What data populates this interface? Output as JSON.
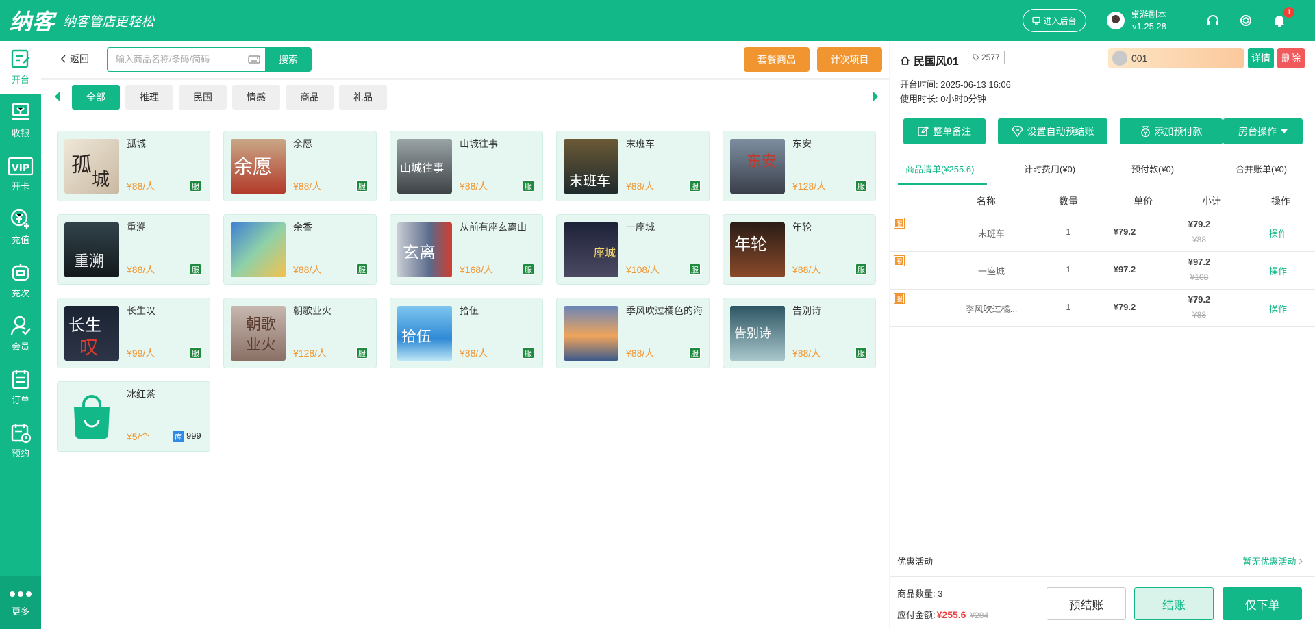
{
  "header": {
    "logo_text": "纳客",
    "slogan": "纳客管店更轻松",
    "enter_backend": "进入后台",
    "user_name": "桌游剧本",
    "version": "v1.25.28",
    "notification_count": "1"
  },
  "nav": {
    "items": [
      {
        "label": "开台",
        "icon": "open-table-icon"
      },
      {
        "label": "收银",
        "icon": "cashier-icon"
      },
      {
        "label": "开卡",
        "icon": "vip-card-icon"
      },
      {
        "label": "充值",
        "icon": "recharge-icon"
      },
      {
        "label": "充次",
        "icon": "recharge-times-icon"
      },
      {
        "label": "会员",
        "icon": "member-icon"
      },
      {
        "label": "订单",
        "icon": "order-icon"
      },
      {
        "label": "预约",
        "icon": "booking-icon"
      }
    ],
    "more": "更多"
  },
  "toolbar": {
    "back": "返回",
    "search_placeholder": "输入商品名称/条码/简码",
    "search_button": "搜索",
    "package_button": "套餐商品",
    "times_button": "计次项目"
  },
  "categories": [
    "全部",
    "推理",
    "民国",
    "情感",
    "商品",
    "礼品"
  ],
  "products": [
    {
      "name": "孤城",
      "price": "¥88/人",
      "tag": "服"
    },
    {
      "name": "余愿",
      "price": "¥88/人",
      "tag": "服"
    },
    {
      "name": "山城往事",
      "price": "¥88/人",
      "tag": "服"
    },
    {
      "name": "末班车",
      "price": "¥88/人",
      "tag": "服"
    },
    {
      "name": "东安",
      "price": "¥128/人",
      "tag": "服"
    },
    {
      "name": "重溯",
      "price": "¥88/人",
      "tag": "服"
    },
    {
      "name": "余香",
      "price": "¥88/人",
      "tag": "服"
    },
    {
      "name": "从前有座玄离山",
      "price": "¥168/人",
      "tag": "服"
    },
    {
      "name": "一座城",
      "price": "¥108/人",
      "tag": "服"
    },
    {
      "name": "年轮",
      "price": "¥88/人",
      "tag": "服"
    },
    {
      "name": "长生叹",
      "price": "¥99/人",
      "tag": "服"
    },
    {
      "name": "朝歌业火",
      "price": "¥128/人",
      "tag": "服"
    },
    {
      "name": "拾伍",
      "price": "¥88/人",
      "tag": "服"
    },
    {
      "name": "季风吹过橘色的海",
      "price": "¥88/人",
      "tag": "服"
    },
    {
      "name": "告别诗",
      "price": "¥88/人",
      "tag": "服"
    },
    {
      "name": "冰红茶",
      "price": "¥5/个",
      "tag": "库",
      "stock": "999"
    }
  ],
  "room": {
    "name": "民国风01",
    "code": "2577",
    "member_no": "001",
    "detail": "详情",
    "delete": "删除",
    "open_time": "开台时间: 2025-06-13 16:06",
    "duration": "使用时长: 0小时0分钟"
  },
  "actions": {
    "note": "整单备注",
    "auto_prebill": "设置自动预结账",
    "add_prepay": "添加预付款",
    "room_ops": "房台操作"
  },
  "tabs": [
    "商品清单(¥255.6)",
    "计时费用(¥0)",
    "预付款(¥0)",
    "合并账单(¥0)"
  ],
  "table": {
    "headers": [
      "名称",
      "数量",
      "单价",
      "小计",
      "操作"
    ],
    "rows": [
      {
        "tag": "服",
        "name": "末班车",
        "qty": "1",
        "unit": "¥79.2",
        "subtotal": "¥79.2",
        "orig": "¥88",
        "op": "操作"
      },
      {
        "tag": "服",
        "name": "一座城",
        "qty": "1",
        "unit": "¥97.2",
        "subtotal": "¥97.2",
        "orig": "¥108",
        "op": "操作"
      },
      {
        "tag": "服",
        "name": "季风吹过橘...",
        "qty": "1",
        "unit": "¥79.2",
        "subtotal": "¥79.2",
        "orig": "¥88",
        "op": "操作"
      }
    ]
  },
  "footer": {
    "promo_label": "优惠活动",
    "promo_value": "暂无优惠活动",
    "item_count": "商品数量: 3",
    "pay_label": "应付金额:",
    "pay_amount": "¥255.6",
    "pay_orig": "¥284",
    "pre_settle": "预结账",
    "settle": "结账",
    "order_only": "仅下单"
  },
  "colors": {
    "primary": "#13b888",
    "orange": "#f19530",
    "danger": "#f05a5a"
  }
}
